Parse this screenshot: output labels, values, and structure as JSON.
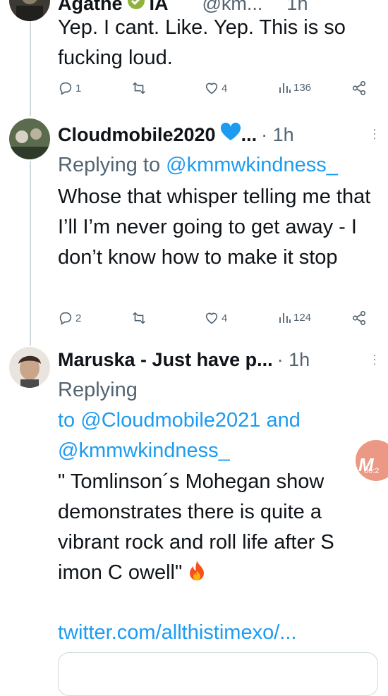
{
  "tweet1": {
    "name": "Agathe",
    "suffix": "IA",
    "handle": "@km...",
    "time": "1h",
    "text": "Yep. I cant. Like. Yep. This is so fucking loud.",
    "stats": {
      "replies": "1",
      "likes": "4",
      "views": "136"
    }
  },
  "tweet2": {
    "name": "Cloudmobile2020",
    "ellipsis": "...",
    "time": "· 1h",
    "replying_prefix": "Replying to ",
    "replying_to": "@kmmwkindness_",
    "text": "Whose that whisper telling me that I’ll I’m never going to get away - I don’t know how to make it stop",
    "stats": {
      "replies": "2",
      "likes": "4",
      "views": "124"
    }
  },
  "tweet3": {
    "name": "Maruska - Just have p...",
    "time": "· 1h",
    "replying_prefix": "Replying",
    "to_word": "to ",
    "mention1": "@Cloudmobile2021",
    "and_word": " and",
    "mention2": "@kmmwkindness_",
    "quote": "\" Tomlinson´s Mohegan show demonstrates there is quite a vibrant rock and roll life after S imon C owell\"",
    "link": "twitter.com/allthistimexo/..."
  },
  "overlay_badge": {
    "label": "M",
    "time": "00:2"
  },
  "colors": {
    "accent": "#1d9bf0",
    "heart_emoji": "#1d9bf0",
    "fire": "#f4511e"
  },
  "icons": [
    "reply-icon",
    "retweet-icon",
    "like-icon",
    "views-icon",
    "share-icon",
    "more-icon",
    "fire-emoji",
    "blue-heart-emoji"
  ]
}
